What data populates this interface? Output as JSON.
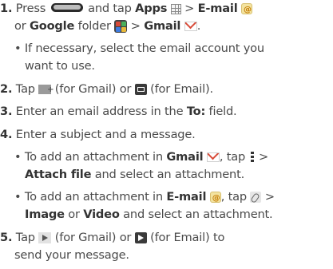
{
  "steps": {
    "s1": {
      "num": "1.",
      "press": "Press",
      "tap": "and tap",
      "apps": "Apps",
      "gt1": ">",
      "email": "E-mail",
      "or": "or",
      "google": "Google",
      "folder": "folder",
      "gt2": ">",
      "gmail": "Gmail",
      "end": ".",
      "sub1_line1": "If necessary, select the email account you",
      "sub1_line2": "want to use."
    },
    "s2": {
      "num": "2.",
      "tap": "Tap",
      "forgmail": "(for Gmail) or",
      "foremail": "(for Email)."
    },
    "s3": {
      "num": "3.",
      "text1": "Enter an email address in the",
      "to": "To:",
      "text2": "field."
    },
    "s4": {
      "num": "4.",
      "text": "Enter a subject and a message.",
      "b1_pre": "To add an attachment in",
      "b1_gmail": "Gmail",
      "b1_tap": ", tap",
      "b1_gt": ">",
      "b1_attach": "Attach file",
      "b1_rest": "and select  an attachment.",
      "b2_pre": "To add an attachment in",
      "b2_email": "E-mail",
      "b2_tap": ", tap",
      "b2_gt": ">",
      "b2_image": "Image",
      "b2_or": "or",
      "b2_video": "Video",
      "b2_rest": "and select an attachment."
    },
    "s5": {
      "num": "5.",
      "tap": "Tap",
      "forgmail": "(for Gmail) or",
      "foremail": "(for Email) to",
      "line2": "send your message."
    }
  },
  "icons": {
    "home": "home-key-icon",
    "apps": "apps-grid-icon",
    "email_app": "email-app-icon",
    "google_folder": "google-folder-icon",
    "gmail": "gmail-icon",
    "compose_gmail": "compose-gmail-icon",
    "compose_email": "compose-email-icon",
    "menu": "menu-dots-icon",
    "paperclip": "paperclip-icon",
    "send_gmail": "send-gmail-icon",
    "send_email": "send-email-icon"
  },
  "colors": {
    "text": "#4a4a4a",
    "bold": "#333333",
    "gmail_red": "#d84a38"
  }
}
